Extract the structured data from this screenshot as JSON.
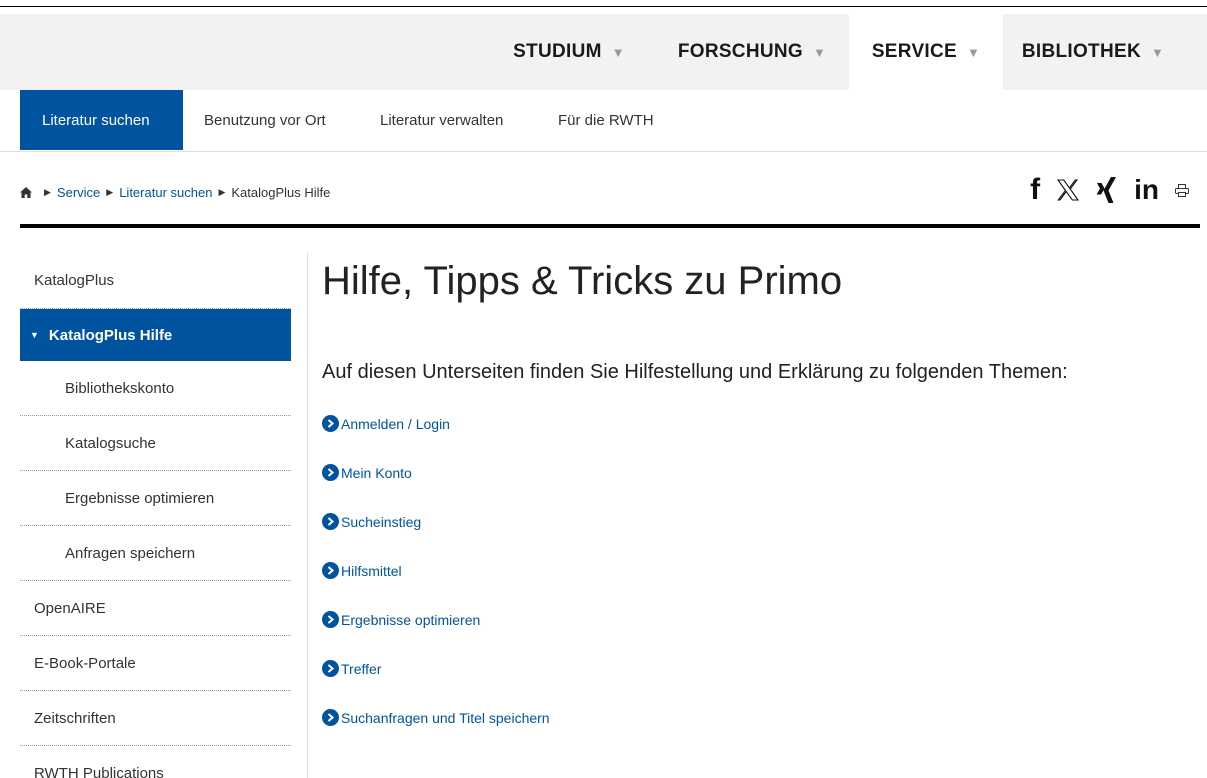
{
  "main_nav": [
    {
      "label": "STUDIUM"
    },
    {
      "label": "FORSCHUNG"
    },
    {
      "label": "SERVICE"
    },
    {
      "label": "BIBLIOTHEK"
    }
  ],
  "sub_nav": [
    {
      "label": "Literatur suchen"
    },
    {
      "label": "Benutzung vor Ort"
    },
    {
      "label": "Literatur verwalten"
    },
    {
      "label": "Für die RWTH"
    }
  ],
  "breadcrumb": {
    "items": [
      "Service",
      "Literatur suchen"
    ],
    "current": "KatalogPlus Hilfe"
  },
  "social": {
    "facebook": "f",
    "linkedin": "in",
    "icons": [
      "facebook-icon",
      "x-twitter-icon",
      "xing-icon",
      "linkedin-icon",
      "print-icon"
    ]
  },
  "sidebar": [
    {
      "label": "KatalogPlus"
    },
    {
      "label": "KatalogPlus Hilfe"
    },
    {
      "label": "Bibliothekskonto"
    },
    {
      "label": "Katalogsuche"
    },
    {
      "label": "Ergebnisse optimieren"
    },
    {
      "label": "Anfragen speichern"
    },
    {
      "label": "OpenAIRE"
    },
    {
      "label": "E-Book-Portale"
    },
    {
      "label": "Zeitschriften"
    },
    {
      "label": "RWTH Publications"
    }
  ],
  "content": {
    "title": "Hilfe, Tipps & Tricks zu Primo",
    "intro": "Auf diesen Unterseiten finden Sie Hilfestellung und Erklärung zu folgenden Themen:",
    "links": [
      {
        "label": "Anmelden / Login"
      },
      {
        "label": "Mein Konto"
      },
      {
        "label": "Sucheinstieg"
      },
      {
        "label": "Hilfsmittel"
      },
      {
        "label": "Ergebnisse optimieren"
      },
      {
        "label": "Treffer"
      },
      {
        "label": "Suchanfragen und Titel speichern"
      }
    ]
  },
  "colors": {
    "accent": "#00549f",
    "nav_bg": "#f2f2f2"
  }
}
